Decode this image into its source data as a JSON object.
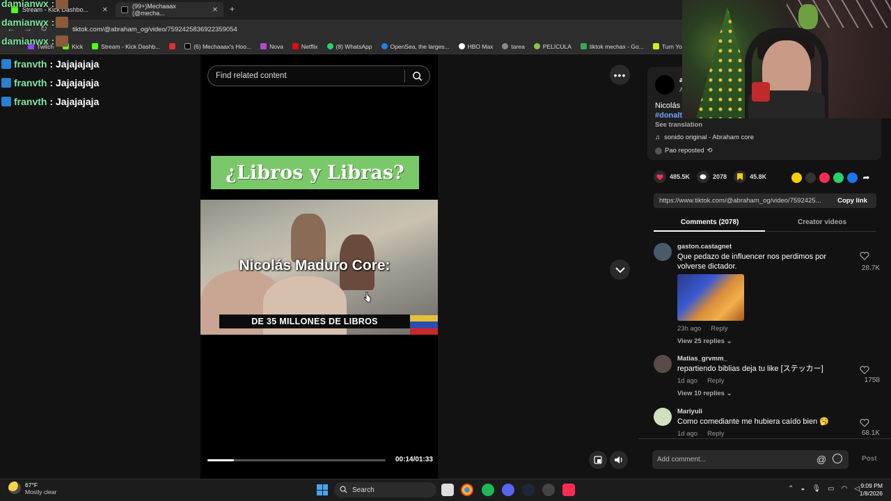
{
  "browser": {
    "tabs": [
      {
        "label": "Stream - Kick Dashbo...",
        "active": false
      },
      {
        "label": "(99+)Mechaaax (@mecha...",
        "active": true
      }
    ],
    "url": "tiktok.com/@abraham_og/video/7592425836922359054",
    "bookmarks": [
      "Twitch",
      "Kick",
      "Stream - Kick Dashb...",
      "",
      "(6) Mechaaax's Hoo...",
      "Nova",
      "Netflix",
      "(8) WhatsApp",
      "OpenSea, the larges...",
      "HBO Max",
      "tarea",
      "PELICULA",
      "tiktok mechax - Go...",
      "Turn Your Skins into..."
    ]
  },
  "chat_overlay": {
    "top_rows": [
      "damianwx :",
      "damianwx :",
      "damianwx :"
    ],
    "lines": [
      {
        "user": "franvth",
        "msg": ": Jajajajaja"
      },
      {
        "user": "franvth",
        "msg": ": Jajajajaja"
      },
      {
        "user": "franvth",
        "msg": ": Jajajajaja"
      }
    ]
  },
  "video": {
    "search_placeholder": "Find related content",
    "title_card": "¿Libros y Libras?",
    "caption_main": "Nicolás Maduro Core:",
    "caption_sub": "DE 35 MILLONES DE LIBROS",
    "time": "00:14/01:33",
    "progress": 0.15
  },
  "post": {
    "user": "a",
    "user_sub": "A",
    "text": "Nicolás",
    "hashtag": "#donalt...",
    "see_translation": "See translation",
    "sound": "sonido original - Abraham core",
    "reposted": "Pao reposted",
    "likes": "485.5K",
    "comments": "2078",
    "saves": "45.8K",
    "link": "https://www.tiktok.com/@abraham_og/video/7592425...",
    "copy_link": "Copy link",
    "tab_comments": "Comments (2078)",
    "tab_creator": "Creator videos"
  },
  "comments": [
    {
      "user": "gaston.castagnet",
      "text": "Que pedazo de influencer nos perdimos por volverse dictador.",
      "time": "23h ago",
      "reply": "Reply",
      "likes": "28.7K",
      "view_replies": "View 25 replies",
      "avatar_color": "#4a5a6a"
    },
    {
      "user": "Matias_grvmm_",
      "text": "repartiendo biblias deja tu like [ステッカー]",
      "time": "1d ago",
      "reply": "Reply",
      "likes": "1758",
      "view_replies": "View 10 replies",
      "avatar_color": "#5a4a4a"
    },
    {
      "user": "Mariyuli",
      "text": "Como comediante me hubiera caído bien 🥱",
      "time": "1d ago",
      "reply": "Reply",
      "likes": "68.1K",
      "view_replies": "",
      "avatar_color": "#d0e0c0"
    }
  ],
  "add_comment": {
    "placeholder": "Add comment...",
    "post": "Post"
  },
  "taskbar": {
    "temp": "67°F",
    "weather": "Mostly clear",
    "search": "Search",
    "time": "9:09 PM",
    "date": "1/8/2026"
  },
  "colors": {
    "accent_pink": "#fe2c55",
    "title_green": "#7bc86a",
    "chat_green": "#7ee8a0"
  }
}
